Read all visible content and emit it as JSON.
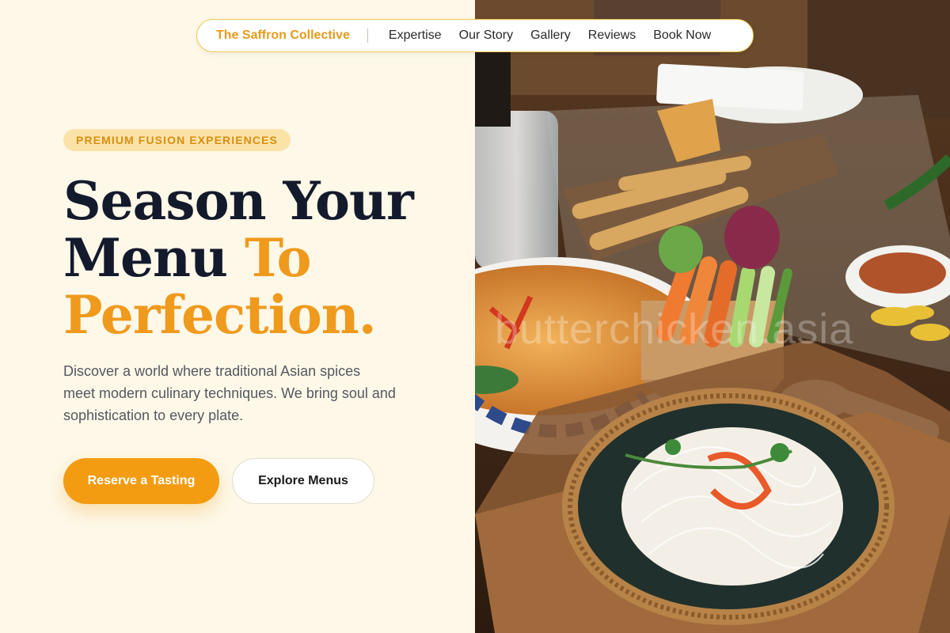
{
  "nav": {
    "brand": "The Saffron Collective",
    "links": [
      "Expertise",
      "Our Story",
      "Gallery",
      "Reviews",
      "Book Now"
    ]
  },
  "hero": {
    "badge": "PREMIUM FUSION EXPERIENCES",
    "headline": {
      "line1": "Season Your",
      "line2_dark": "Menu ",
      "line2_accent": "To",
      "line3_accent": "Perfection."
    },
    "description": "Discover a world where traditional Asian spices meet modern culinary techniques. We bring soul and sophistication to every plate.",
    "primary_button": "Reserve a Tasting",
    "secondary_button": "Explore Menus"
  },
  "image": {
    "watermark": "butterchicken.asia"
  },
  "colors": {
    "accent": "#f39c12",
    "background": "#fdf8e8",
    "heading": "#131a2c",
    "badge_bg": "#fbe3a8"
  }
}
